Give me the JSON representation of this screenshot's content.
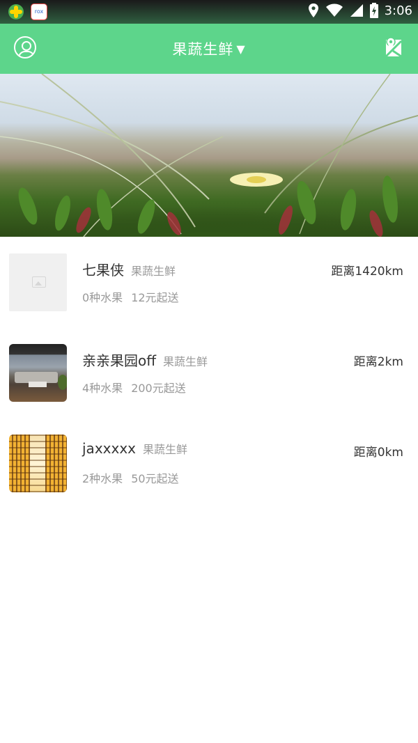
{
  "status_bar": {
    "app2_label": "rox",
    "time": "3:06"
  },
  "header": {
    "title": "果蔬生鲜",
    "caret": "▼",
    "accent_color": "#5dd58b"
  },
  "banner": {
    "slide_count": 5,
    "active_index": 3
  },
  "stores": [
    {
      "name": "七果侠",
      "category": "果蔬生鲜",
      "distance": "距离1420km",
      "fruit_count": "0种水果",
      "min_order": "12元起送"
    },
    {
      "name": "亲亲果园off",
      "category": "果蔬生鲜",
      "distance": "距离2km",
      "fruit_count": "4种水果",
      "min_order": "200元起送"
    },
    {
      "name": "jaxxxxx",
      "category": "果蔬生鲜",
      "distance": "距离0km",
      "fruit_count": "2种水果",
      "min_order": "50元起送"
    }
  ]
}
